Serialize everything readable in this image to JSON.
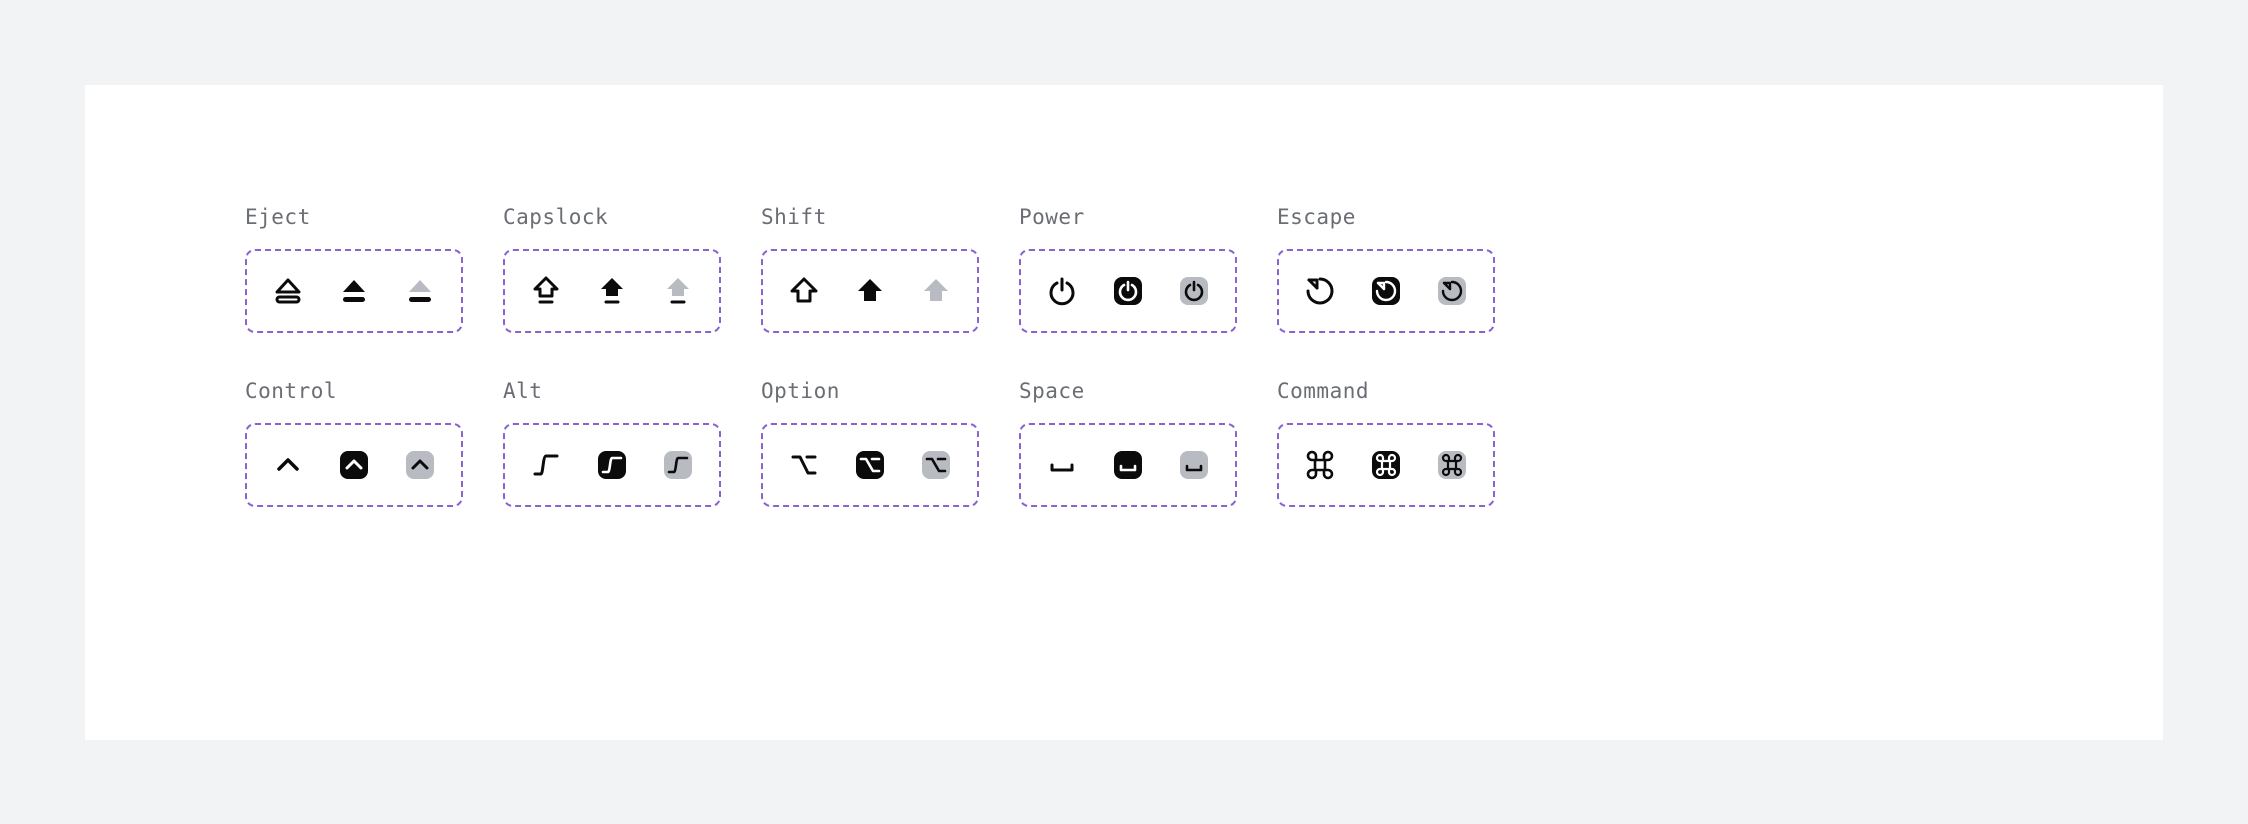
{
  "groups": [
    {
      "id": "eject",
      "label": "Eject"
    },
    {
      "id": "capslock",
      "label": "Capslock"
    },
    {
      "id": "shift",
      "label": "Shift"
    },
    {
      "id": "power",
      "label": "Power"
    },
    {
      "id": "escape",
      "label": "Escape"
    },
    {
      "id": "control",
      "label": "Control"
    },
    {
      "id": "alt",
      "label": "Alt"
    },
    {
      "id": "option",
      "label": "Option"
    },
    {
      "id": "space",
      "label": "Space"
    },
    {
      "id": "command",
      "label": "Command"
    }
  ],
  "variants": [
    "outline",
    "filled",
    "tinted"
  ],
  "colors": {
    "ink": "#0b0b0b",
    "tint": "#b9bbc2",
    "border": "#8a63d2",
    "label": "#6a6d73"
  }
}
